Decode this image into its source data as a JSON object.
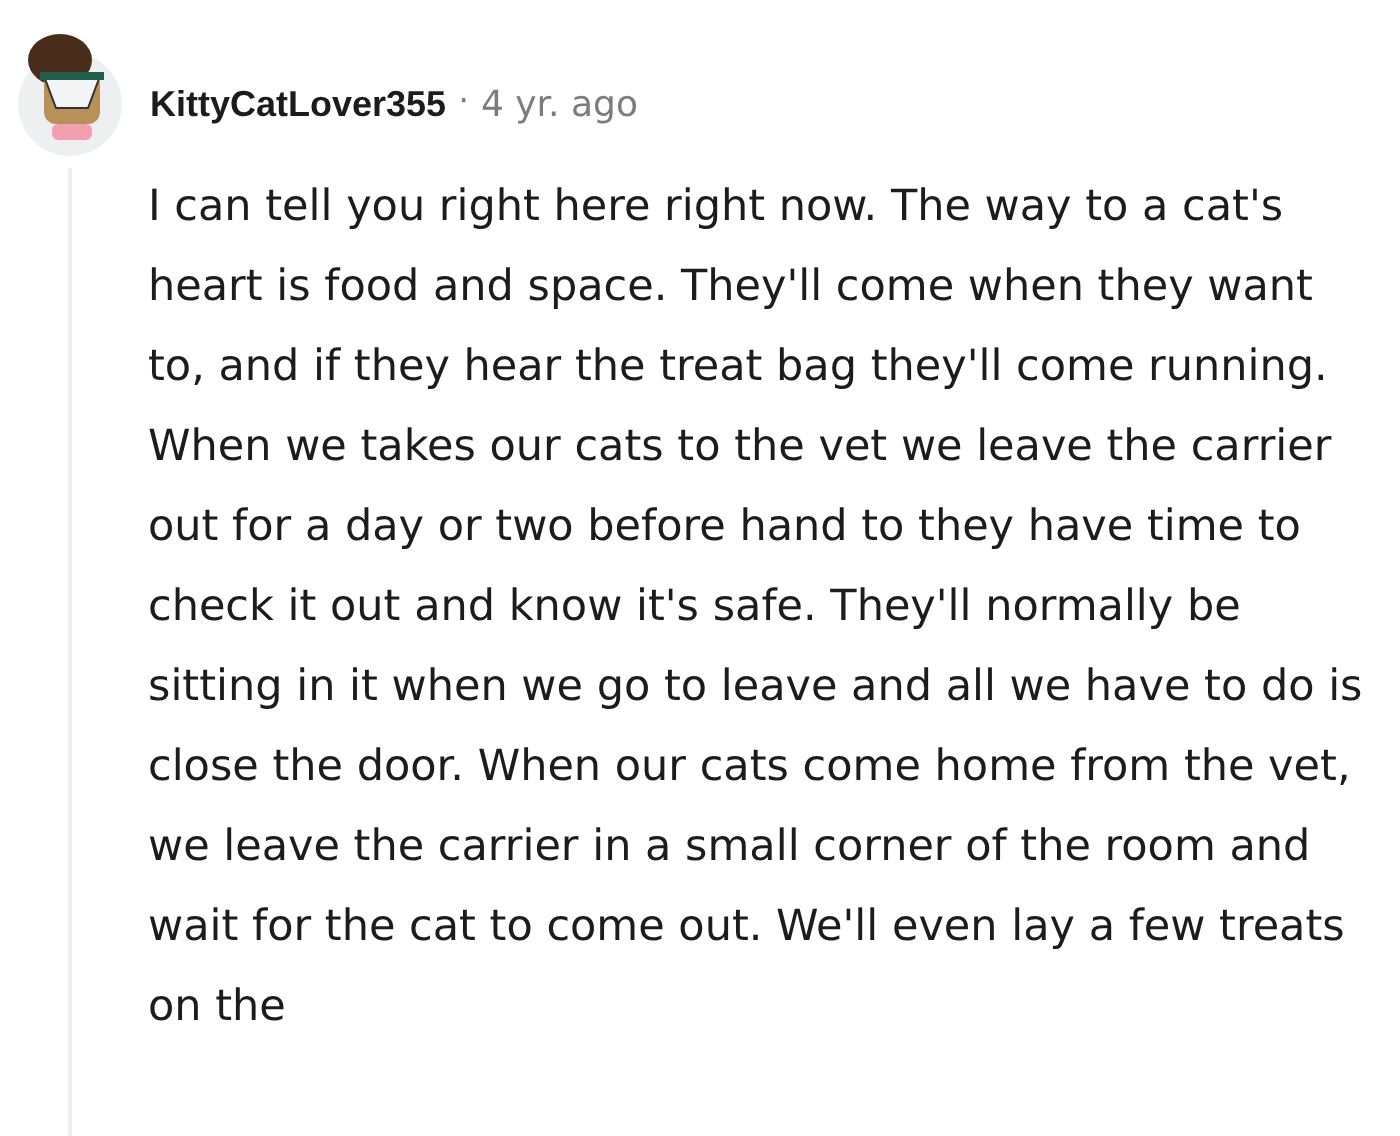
{
  "comment": {
    "author": "KittyCatLover355",
    "separator": "·",
    "time": "4 yr. ago",
    "body": "I can tell you right here right now. The way to a cat's heart is food and space. They'll come when they want to, and if they hear the treat bag they'll come running. When we takes our cats to the vet we leave the carrier out for a day or two before hand to they have time to check it out and know it's safe. They'll normally be sitting in it when we go to leave and all we have to do is close the door. When our cats come home from the vet, we leave the carrier in a small corner of the room and wait for the cat to come out. We'll even lay a few treats on the"
  }
}
